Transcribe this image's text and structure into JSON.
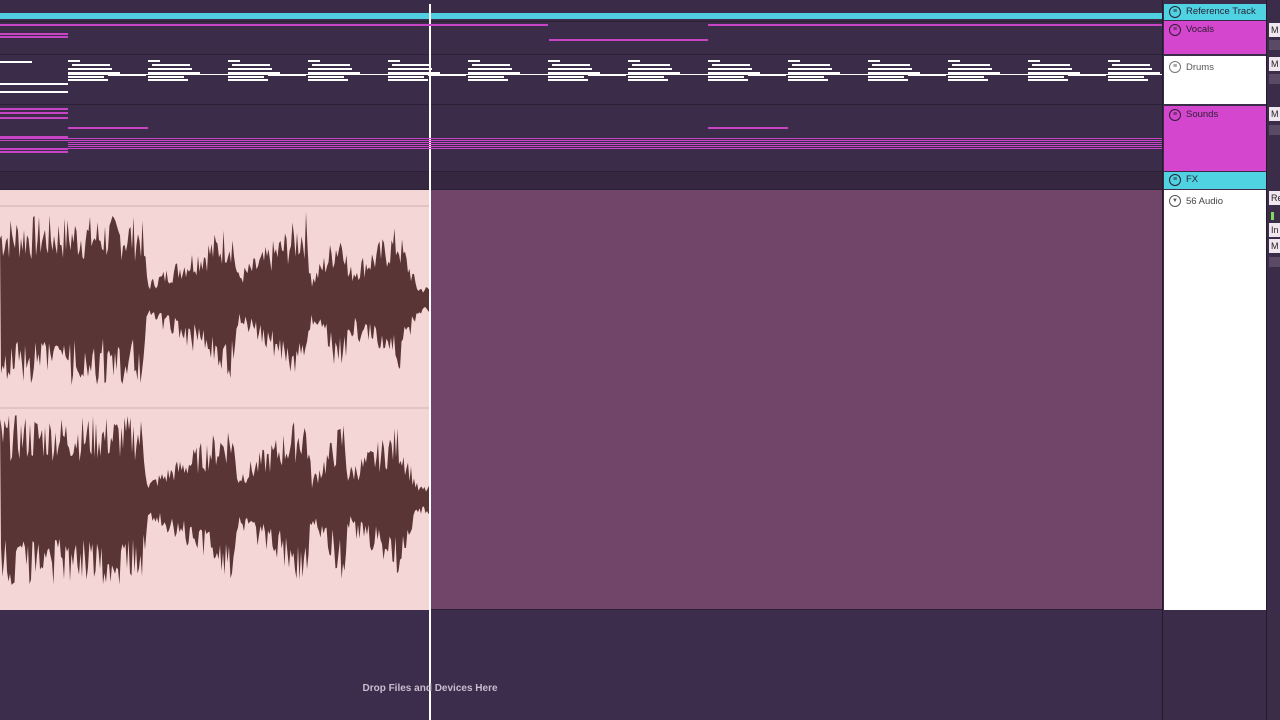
{
  "tracks": [
    {
      "id": "ref",
      "name": "Reference Track",
      "color": "#4fd3e2"
    },
    {
      "id": "vocals",
      "name": "Vocals",
      "color": "#d546cf"
    },
    {
      "id": "drums",
      "name": "Drums",
      "color": "#ffffff"
    },
    {
      "id": "sounds",
      "name": "Sounds",
      "color": "#d546cf"
    },
    {
      "id": "fx",
      "name": "FX",
      "color": "#4fd3e2"
    },
    {
      "id": "audio",
      "name": "56 Audio",
      "color": "#ffffff"
    }
  ],
  "drop_zone": {
    "text": "Drop Files and Devices Here"
  },
  "mixer_labels": {
    "m": "M",
    "r": "Re",
    "i": "In"
  },
  "icons": {
    "group_fold": "group-fold-icon",
    "track_expand": "chevron-down-icon"
  },
  "colors": {
    "arrangement_bg": "#3f2f4f",
    "audio_region_bg": "#714469",
    "audio_clip_bg": "#f5d6d6",
    "waveform": "#5a3535",
    "midi_pink": "#c744c4",
    "reference_cyan": "#4fcfe0"
  }
}
